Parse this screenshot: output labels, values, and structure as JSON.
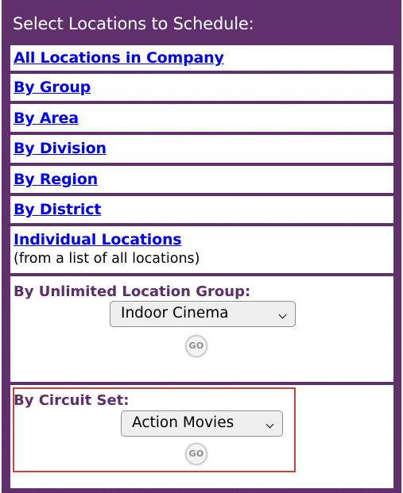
{
  "panel": {
    "title": "Select Locations to Schedule:",
    "background_color": "#5e2d6b",
    "link_color": "#0000ee",
    "highlight_color": "#c74141"
  },
  "links": {
    "all_locations": "All Locations in Company",
    "by_group": "By Group",
    "by_area": "By Area",
    "by_division": "By Division",
    "by_region": "By Region",
    "by_district": "By District",
    "individual_locations": "Individual Locations",
    "individual_locations_note": "(from a list of all locations)"
  },
  "unlimited_group": {
    "label": "By Unlimited Location Group:",
    "selected": "Indoor Cinema",
    "go_label": "GO"
  },
  "circuit_set": {
    "label": "By Circuit Set:",
    "selected": "Action Movies",
    "go_label": "GO"
  }
}
